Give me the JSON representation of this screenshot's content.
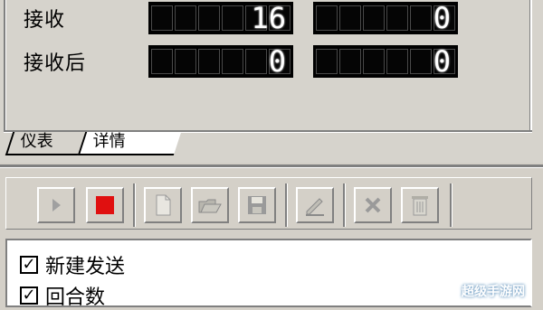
{
  "monitor": {
    "rows": [
      {
        "label": "接收",
        "value_a": "16",
        "value_b": "0"
      },
      {
        "label": "接收后",
        "value_a": "0",
        "value_b": "0"
      }
    ]
  },
  "tabs": [
    {
      "label": "仪表",
      "active": false
    },
    {
      "label": "详情",
      "active": true
    }
  ],
  "toolbar": {
    "buttons": [
      {
        "icon": "play-icon",
        "enabled": false
      },
      {
        "icon": "stop-icon",
        "enabled": true,
        "color": "#e01010"
      },
      {
        "icon": "new-document-icon",
        "enabled": false
      },
      {
        "icon": "open-folder-icon",
        "enabled": false
      },
      {
        "icon": "save-icon",
        "enabled": false
      },
      {
        "icon": "edit-pencil-icon",
        "enabled": false
      },
      {
        "icon": "delete-x-icon",
        "enabled": false
      },
      {
        "icon": "trash-icon",
        "enabled": false
      }
    ]
  },
  "options": [
    {
      "label": "新建发送",
      "checked": true
    },
    {
      "label": "回合数",
      "checked": true
    }
  ],
  "watermark": "超级手游网"
}
